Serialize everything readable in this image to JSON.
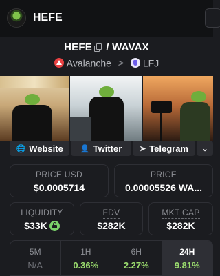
{
  "header": {
    "title": "HEFE"
  },
  "pair": {
    "base": "HEFE",
    "separator": "/",
    "quote": "WAVAX"
  },
  "chain": {
    "name": "Avalanche",
    "chevron": ">",
    "dex": "LFJ"
  },
  "social": {
    "website": "Website",
    "twitter": "Twitter",
    "telegram": "Telegram",
    "more_icon": "⌄"
  },
  "stats": {
    "price_usd": {
      "label": "PRICE USD",
      "value": "$0.0005714"
    },
    "price": {
      "label": "PRICE",
      "value": "0.00005526 WA..."
    },
    "liquidity": {
      "label": "LIQUIDITY",
      "value": "$33K"
    },
    "fdv": {
      "label": "FDV",
      "value": "$282K"
    },
    "mkt_cap": {
      "label": "MKT CAP",
      "value": "$282K"
    }
  },
  "timeframes": [
    {
      "label": "5M",
      "value": "N/A"
    },
    {
      "label": "1H",
      "value": "0.36%"
    },
    {
      "label": "6H",
      "value": "2.27%"
    },
    {
      "label": "24H",
      "value": "9.81%"
    }
  ],
  "colors": {
    "positive": "#9bdc6e",
    "avalanche": "#e84142",
    "lock": "#7ad26a"
  }
}
